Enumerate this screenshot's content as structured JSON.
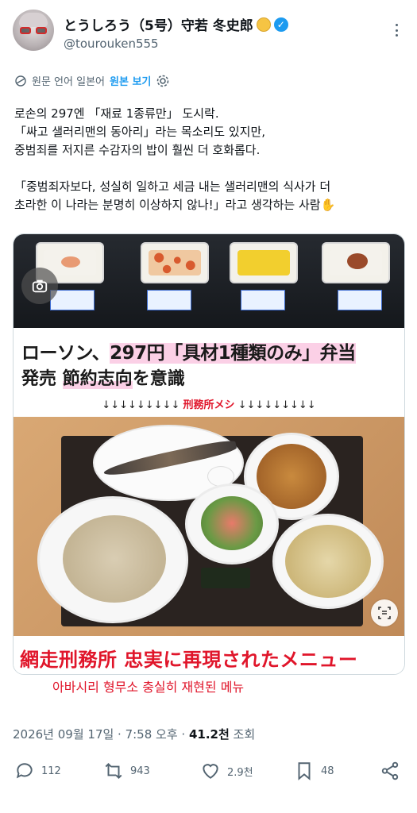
{
  "author": {
    "display_name": "とうしろう（5号）守若 冬史郎",
    "handle": "@tourouken555",
    "verified": true,
    "avatar": "avatar"
  },
  "translation_bar": {
    "source_language": "원문 언어 일본어",
    "show_original": "원본 보기"
  },
  "tweet": {
    "lines": [
      "로손의 297엔 「재료 1종류만」 도시락.",
      "「싸고 샐러리맨의 동아리」라는 목소리도 있지만,",
      "중범죄를 저지른 수감자의 밥이 훨씬 더 호화롭다.",
      "",
      "「중범죄자보다, 성실히 일하고 세금 내는 샐러리맨의 식사가 더",
      "초라한 이 나라는 분명히 이상하지 않나!」라고 생각하는 사람✋"
    ]
  },
  "media": {
    "headline_line1_pre": "ローソン、",
    "headline_line1_price": "297円",
    "headline_line1_post": "「具材1種類のみ」弁当",
    "headline_line2_pre": "発売 ",
    "headline_line2_em": "節約志向",
    "headline_line2_post": "を意識",
    "arrows_left": "↓↓↓↓↓↓↓↓↓",
    "arrows_label": "刑務所メシ",
    "arrows_right": "↓↓↓↓↓↓↓↓↓",
    "bottom_caption": "網走刑務所 忠実に再現されたメニュー",
    "translation": "아바시리 형무소 충실히 재현된 메뉴"
  },
  "meta": {
    "date": "2026년 09월 17일 · 7:58 오후 · ",
    "views": "41.2천",
    "views_label": " 조회"
  },
  "actions": {
    "replies": "112",
    "reposts": "943",
    "likes": "2.9천",
    "bookmarks": "48"
  },
  "colors": {
    "accent": "#1d9bf0",
    "caption_red": "#e0152a",
    "highlight_pink": "#fbd0e6",
    "secondary_text": "#536471"
  }
}
